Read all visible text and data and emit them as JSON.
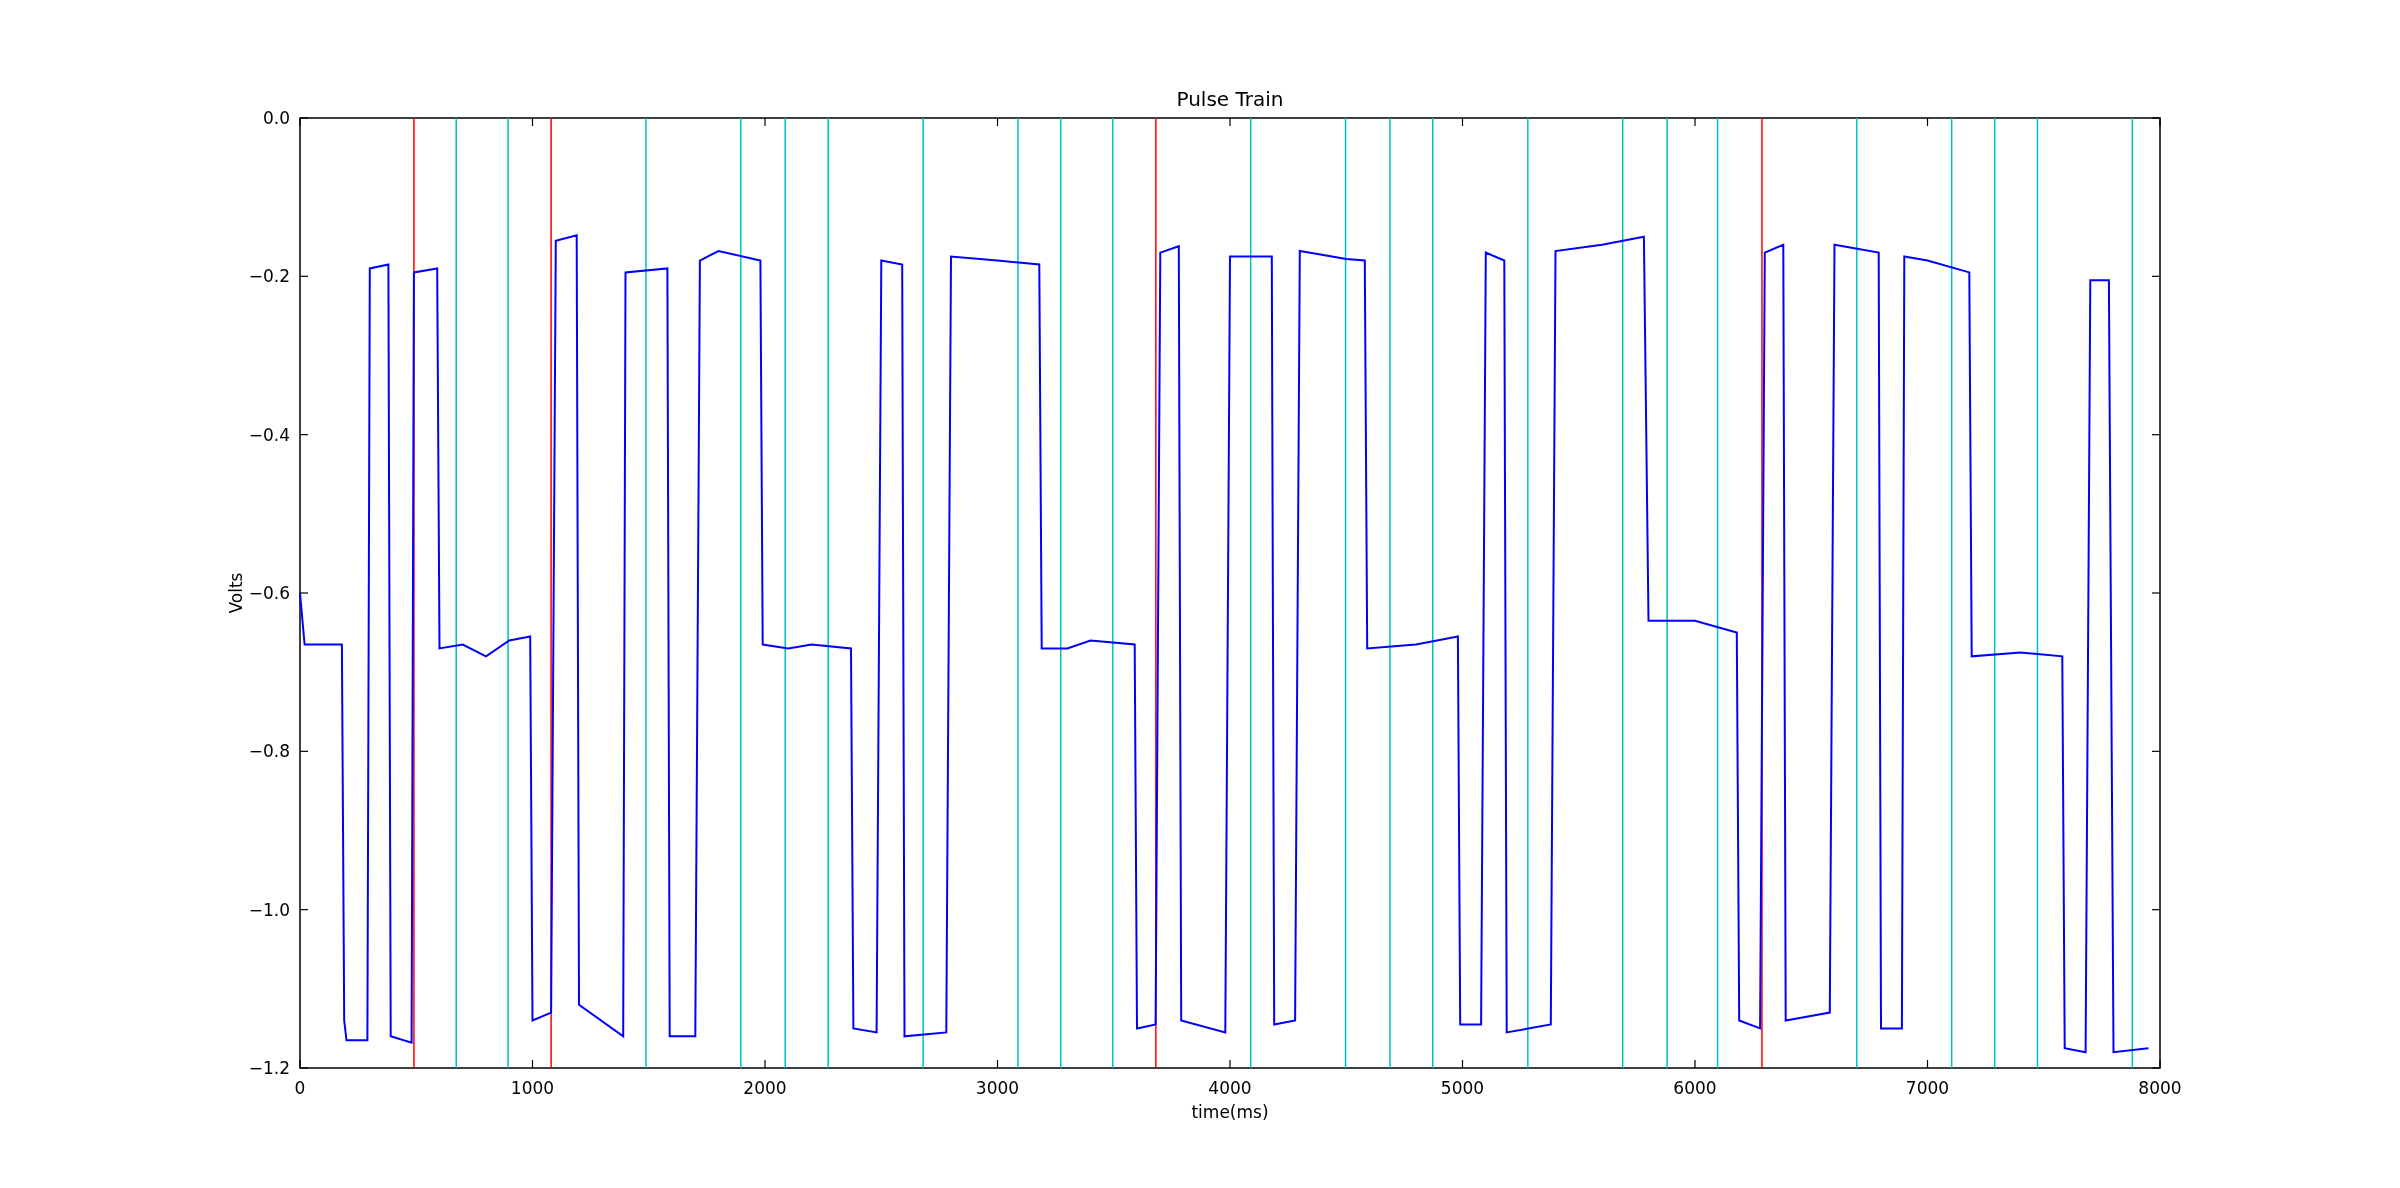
{
  "chart_data": {
    "type": "line",
    "title": "Pulse Train",
    "xlabel": "time(ms)",
    "ylabel": "Volts",
    "xlim": [
      0,
      8000
    ],
    "ylim": [
      -1.2,
      0
    ],
    "xticks": [
      0,
      1000,
      2000,
      3000,
      4000,
      5000,
      6000,
      7000,
      8000
    ],
    "yticks": [
      {
        "value": 0,
        "label": "0.0"
      },
      {
        "value": -0.2,
        "label": "−0.2"
      },
      {
        "value": -0.4,
        "label": "−0.4"
      },
      {
        "value": -0.6,
        "label": "−0.6"
      },
      {
        "value": -0.8,
        "label": "−0.8"
      },
      {
        "value": -1.0,
        "label": "−1.0"
      },
      {
        "value": -1.2,
        "label": "−1.2"
      }
    ],
    "x": [
      0,
      20,
      180,
      190,
      200,
      290,
      300,
      380,
      390,
      480,
      490,
      590,
      600,
      700,
      800,
      900,
      990,
      1000,
      1080,
      1100,
      1190,
      1200,
      1390,
      1400,
      1580,
      1590,
      1700,
      1720,
      1800,
      1980,
      1990,
      2100,
      2200,
      2370,
      2380,
      2480,
      2500,
      2590,
      2600,
      2780,
      2800,
      3000,
      3180,
      3190,
      3300,
      3400,
      3590,
      3600,
      3680,
      3700,
      3780,
      3790,
      3980,
      4000,
      4180,
      4190,
      4280,
      4300,
      4500,
      4580,
      4590,
      4800,
      4980,
      4990,
      5080,
      5100,
      5180,
      5190,
      5380,
      5400,
      5600,
      5780,
      5800,
      6000,
      6180,
      6190,
      6280,
      6300,
      6380,
      6390,
      6580,
      6600,
      6790,
      6800,
      6890,
      6900,
      7000,
      7180,
      7190,
      7400,
      7580,
      7590,
      7680,
      7700,
      7780,
      7800,
      7950
    ],
    "series": [
      {
        "color": "#0000ff",
        "values": [
          -0.6,
          -0.665,
          -0.665,
          -1.14,
          -1.165,
          -1.165,
          -0.19,
          -0.185,
          -1.16,
          -1.168,
          -0.195,
          -0.19,
          -0.67,
          -0.665,
          -0.68,
          -0.66,
          -0.655,
          -1.14,
          -1.13,
          -0.155,
          -0.148,
          -1.12,
          -1.16,
          -0.195,
          -0.19,
          -1.16,
          -1.16,
          -0.18,
          -0.168,
          -0.18,
          -0.665,
          -0.67,
          -0.665,
          -0.67,
          -1.15,
          -1.155,
          -0.18,
          -0.185,
          -1.16,
          -1.155,
          -0.175,
          -0.18,
          -0.185,
          -0.67,
          -0.67,
          -0.66,
          -0.665,
          -1.15,
          -1.145,
          -0.17,
          -0.162,
          -1.14,
          -1.155,
          -0.175,
          -0.175,
          -1.145,
          -1.14,
          -0.168,
          -0.178,
          -0.18,
          -0.67,
          -0.665,
          -0.655,
          -1.145,
          -1.145,
          -0.17,
          -0.18,
          -1.155,
          -1.145,
          -0.168,
          -0.16,
          -0.15,
          -0.635,
          -0.635,
          -0.65,
          -1.14,
          -1.15,
          -0.17,
          -0.16,
          -1.14,
          -1.13,
          -0.16,
          -0.17,
          -1.15,
          -1.15,
          -0.175,
          -0.18,
          -0.195,
          -0.68,
          -0.675,
          -0.68,
          -1.175,
          -1.18,
          -0.205,
          -0.205,
          -1.18,
          -1.175
        ]
      }
    ],
    "ref_lines": [
      {
        "axis": "x",
        "value": 490,
        "color": "#ff0000"
      },
      {
        "axis": "x",
        "value": 672,
        "color": "#00bfbf"
      },
      {
        "axis": "x",
        "value": 895,
        "color": "#00bfbf"
      },
      {
        "axis": "x",
        "value": 1080,
        "color": "#ff0000"
      },
      {
        "axis": "x",
        "value": 1488,
        "color": "#00bfbf"
      },
      {
        "axis": "x",
        "value": 1896,
        "color": "#00bfbf"
      },
      {
        "axis": "x",
        "value": 2087,
        "color": "#00bfbf"
      },
      {
        "axis": "x",
        "value": 2272,
        "color": "#00bfbf"
      },
      {
        "axis": "x",
        "value": 2680,
        "color": "#00bfbf"
      },
      {
        "axis": "x",
        "value": 3088,
        "color": "#00bfbf"
      },
      {
        "axis": "x",
        "value": 3272,
        "color": "#00bfbf"
      },
      {
        "axis": "x",
        "value": 3496,
        "color": "#00bfbf"
      },
      {
        "axis": "x",
        "value": 3681,
        "color": "#ff0000"
      },
      {
        "axis": "x",
        "value": 4089,
        "color": "#00bfbf"
      },
      {
        "axis": "x",
        "value": 4497,
        "color": "#00bfbf"
      },
      {
        "axis": "x",
        "value": 4688,
        "color": "#00bfbf"
      },
      {
        "axis": "x",
        "value": 4872,
        "color": "#00bfbf"
      },
      {
        "axis": "x",
        "value": 5281,
        "color": "#00bfbf"
      },
      {
        "axis": "x",
        "value": 5689,
        "color": "#00bfbf"
      },
      {
        "axis": "x",
        "value": 5880,
        "color": "#00bfbf"
      },
      {
        "axis": "x",
        "value": 6097,
        "color": "#00bfbf"
      },
      {
        "axis": "x",
        "value": 6288,
        "color": "#ff0000"
      },
      {
        "axis": "x",
        "value": 6696,
        "color": "#00bfbf"
      },
      {
        "axis": "x",
        "value": 7104,
        "color": "#00bfbf"
      },
      {
        "axis": "x",
        "value": 7289,
        "color": "#00bfbf"
      },
      {
        "axis": "x",
        "value": 7473,
        "color": "#00bfbf"
      },
      {
        "axis": "x",
        "value": 7881,
        "color": "#00bfbf"
      }
    ]
  }
}
